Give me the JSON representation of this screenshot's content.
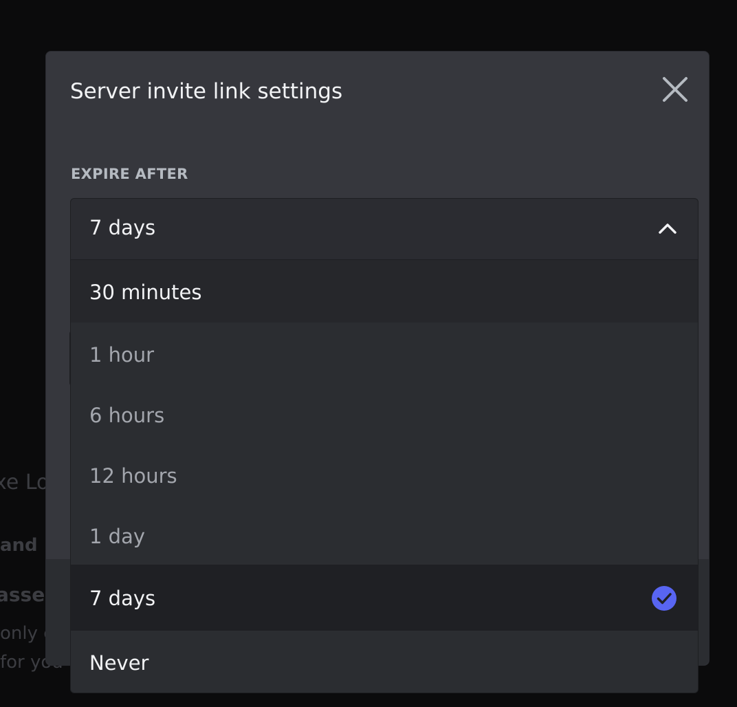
{
  "background": {
    "fragments": [
      "xe Lo",
      "and",
      "asse",
      "only c",
      "for you"
    ]
  },
  "modal": {
    "title": "Server invite link settings",
    "close_icon": "close-icon",
    "expire_label": "EXPIRE AFTER",
    "select": {
      "value": "7 days",
      "chevron_icon": "chevron-up-icon"
    },
    "options": [
      {
        "label": "30 minutes"
      },
      {
        "label": "1 hour"
      },
      {
        "label": "6 hours"
      },
      {
        "label": "12 hours"
      },
      {
        "label": "1 day"
      },
      {
        "label": "7 days",
        "selected": true
      },
      {
        "label": "Never"
      }
    ],
    "check_icon": "checkmark-circle-icon"
  },
  "colors": {
    "accent": "#5865f2",
    "modal_bg": "#36373d",
    "dropdown_bg": "#2b2d31",
    "selected_bg": "#1f2024"
  }
}
